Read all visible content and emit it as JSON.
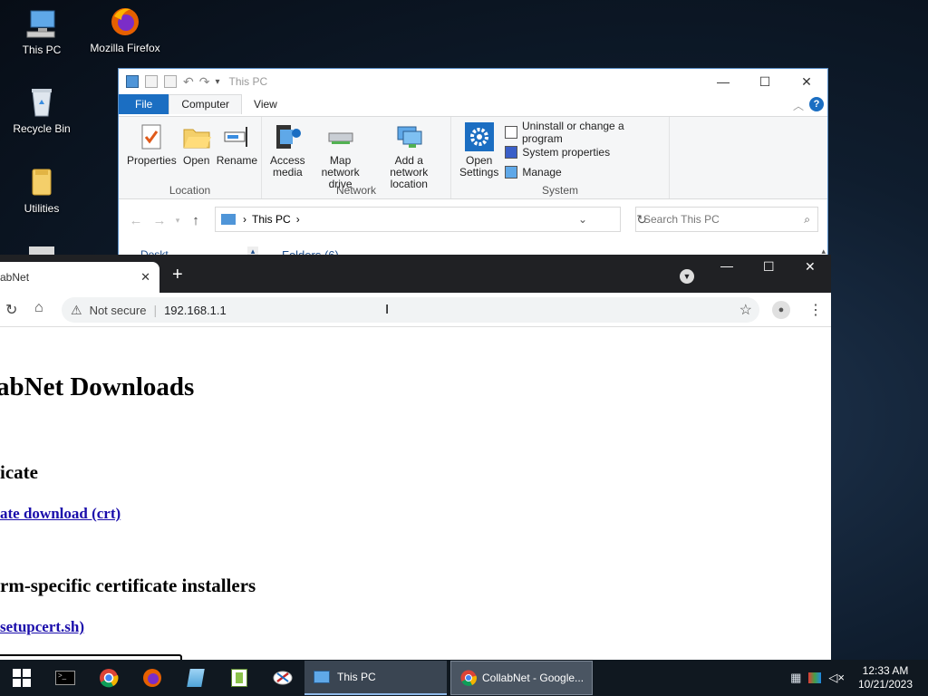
{
  "desktop": {
    "icons": [
      {
        "label": "This PC"
      },
      {
        "label": "Mozilla Firefox"
      },
      {
        "label": "Recycle Bin"
      },
      {
        "label": "Utilities"
      }
    ]
  },
  "explorer": {
    "title": "This PC",
    "tabs": {
      "file": "File",
      "computer": "Computer",
      "view": "View"
    },
    "location_group": {
      "label": "Location",
      "buttons": [
        "Properties",
        "Open",
        "Rename"
      ]
    },
    "network_group": {
      "label": "Network",
      "access_media": [
        "Access",
        "media"
      ],
      "map_drive": [
        "Map network",
        "drive"
      ],
      "add_location": [
        "Add a network",
        "location"
      ]
    },
    "system_group": {
      "label": "System",
      "open_settings": [
        "Open",
        "Settings"
      ],
      "items": [
        "Uninstall or change a program",
        "System properties",
        "Manage"
      ]
    },
    "address": {
      "path": "This PC"
    },
    "search": {
      "placeholder": "Search This PC"
    },
    "nav_peek": {
      "left": "Deskt",
      "right": "Folders (6)"
    }
  },
  "chrome": {
    "tab_title": "abNet",
    "new_tab": "+",
    "security_label": "Not secure",
    "url": "192.168.1.1",
    "page": {
      "heading": "abNet Downloads",
      "section1_heading": "icate",
      "section1_link": "ate download (crt)",
      "section2_heading": "rm-specific certificate installers",
      "section2_link": "setupcert.sh)"
    }
  },
  "taskbar": {
    "tasks": [
      {
        "label": "This PC"
      },
      {
        "label": "CollabNet - Google..."
      }
    ],
    "clock": {
      "time": "12:33 AM",
      "date": "10/21/2023"
    }
  },
  "colors": {
    "accent": "#1b6ec2",
    "chrome_frame": "#202124",
    "link": "#1a0dab",
    "taskbar": "#101820"
  }
}
